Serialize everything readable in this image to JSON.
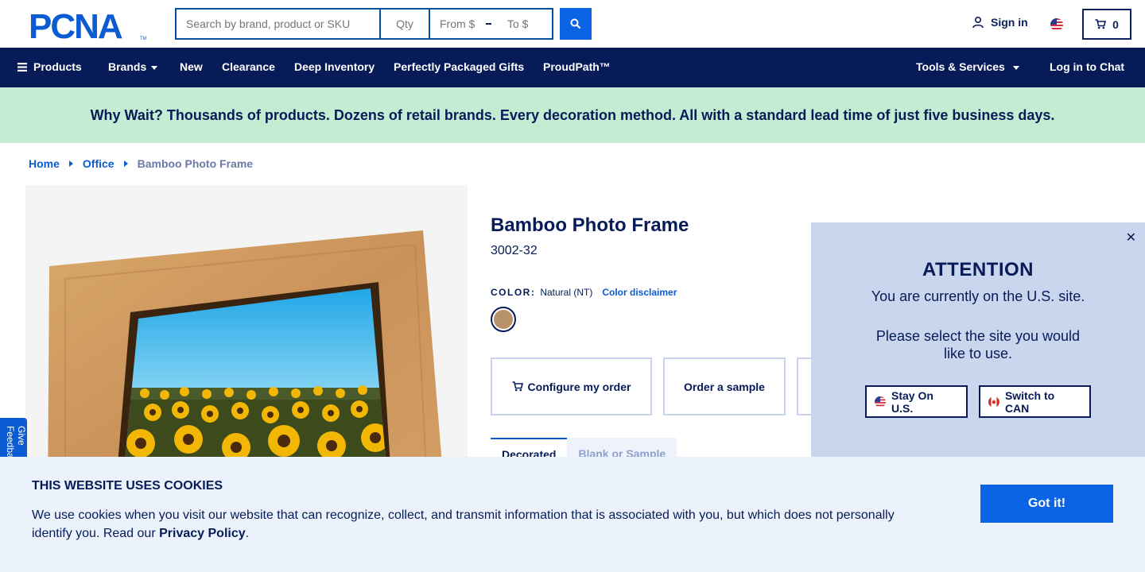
{
  "header": {
    "logo_text": "PCNA",
    "search_placeholder": "Search by brand, product or SKU",
    "qty_placeholder": "Qty",
    "from_placeholder": "From $",
    "to_placeholder": "To $",
    "signin_label": "Sign in",
    "cart_count": "0"
  },
  "nav": {
    "products": "Products",
    "brands": "Brands",
    "new": "New",
    "clearance": "Clearance",
    "deep_inventory": "Deep Inventory",
    "gifts": "Perfectly Packaged Gifts",
    "proudpath": "ProudPath™",
    "tools": "Tools & Services",
    "chat": "Log in to Chat"
  },
  "banner": {
    "text": "Why Wait? Thousands of products. Dozens of retail brands. Every decoration method. All with a standard lead time of just five business days."
  },
  "breadcrumb": {
    "home": "Home",
    "office": "Office",
    "current": "Bamboo Photo Frame"
  },
  "product": {
    "title": "Bamboo Photo Frame",
    "sku": "3002-32",
    "color_label": "COLOR:",
    "color_value": "Natural (NT)",
    "color_disclaimer": "Color disclaimer",
    "swatch_color": "#b8926a",
    "configure_label": "Configure my order",
    "sample_label": "Order a sample",
    "tab_active": "Decorated",
    "tab_inactive": "Blank or Sample"
  },
  "feedback": {
    "label": "Give Feedback"
  },
  "attention": {
    "close": "✕",
    "title": "ATTENTION",
    "line1": "You are currently on the U.S. site.",
    "line2": "Please select the site you would like to use.",
    "stay_label": "Stay On U.S.",
    "switch_label": "Switch to CAN"
  },
  "cookie": {
    "title": "THIS WEBSITE USES COOKIES",
    "text": "We use cookies when you visit our website that can recognize, collect, and transmit information that is associated with you, but which does not personally identify you. Read our",
    "link": "Privacy Policy",
    "period": ".",
    "button": "Got it!"
  },
  "colors": {
    "navy": "#061b57",
    "brand_blue": "#0b63e5",
    "banner_green": "#c4ecd3",
    "modal_bg": "#c9d6ee",
    "cookie_bg": "#ebf2fc"
  }
}
